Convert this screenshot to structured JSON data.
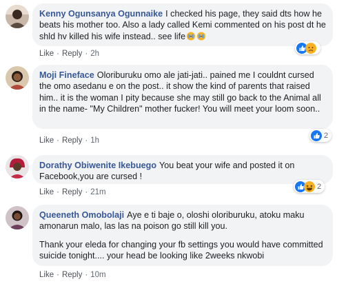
{
  "colors": {
    "author": "#385898",
    "bubble": "#f2f3f5",
    "like_blue": "#1877f2",
    "haha_yellow": "#f7b125"
  },
  "actions": {
    "like": "Like",
    "dot": "·",
    "reply": "Reply"
  },
  "comments": [
    {
      "author": "Kenny Ogunsanya Ogunnaike",
      "text": "I checked his page, they said dts how he beats his mother too. Also a lady called Kemi commented on his post dt he shld hv killed his wife instead.. see life",
      "text2": "",
      "emojis": [
        "crying-face",
        "crying-face"
      ],
      "time": "2h",
      "reactions": [
        "like",
        "sad"
      ],
      "reaction_count": "",
      "avatar_icon": "man-portrait"
    },
    {
      "author": "Moji Fineface",
      "text": "Oloriburuku omo ale jati-jati.. pained me I couldnt cursed the omo asedanu e on the post.. it show the kind of parents that raised him.. it is the woman I pity because she may still go back to the Animal all in the name- \"My Children\" mother fucker! You will meet your loom soon..",
      "text2": "",
      "emojis": [],
      "time": "1h",
      "reactions": [
        "like"
      ],
      "reaction_count": "2",
      "avatar_icon": "woman-portrait"
    },
    {
      "author": "Dorathy Obiwenite Ikebuego",
      "text": "You beat your wife and posted it on Facebook,you are cursed !",
      "text2": "",
      "emojis": [],
      "time": "21m",
      "reactions": [
        "like",
        "haha"
      ],
      "reaction_count": "2",
      "avatar_icon": "woman-red-portrait"
    },
    {
      "author": "Queeneth Omobolaji",
      "text": "Aye e ti baje o, oloshi oloriburuku, atoku maku amonarun malo, las las na poison go still kill you.",
      "text2": "Thank your eleda for changing your fb settings you would have committed suicide tonight.... your head be looking like 2weeks nkwobi",
      "emojis": [],
      "time": "10m",
      "reactions": [],
      "reaction_count": "",
      "avatar_icon": "woman-portrait"
    }
  ]
}
